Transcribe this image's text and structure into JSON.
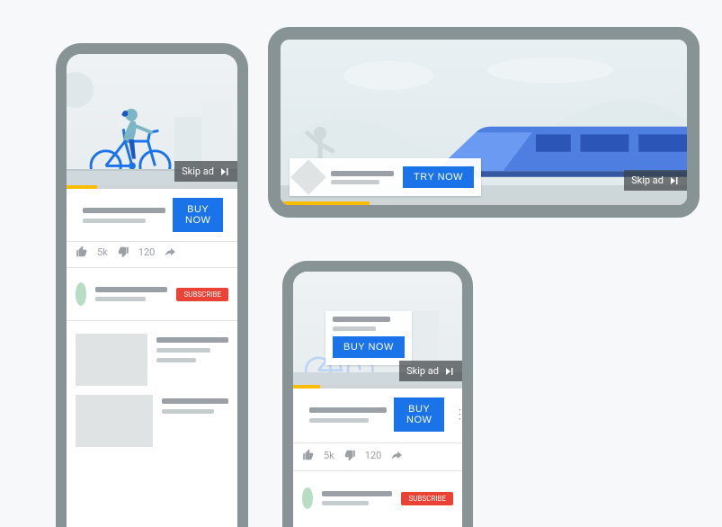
{
  "labels": {
    "skip": "Skip ad",
    "buy": "BUY NOW",
    "try": "TRY NOW",
    "subscribe": "SUBSCRIBE",
    "likes": "5k",
    "dislikes": "120"
  }
}
